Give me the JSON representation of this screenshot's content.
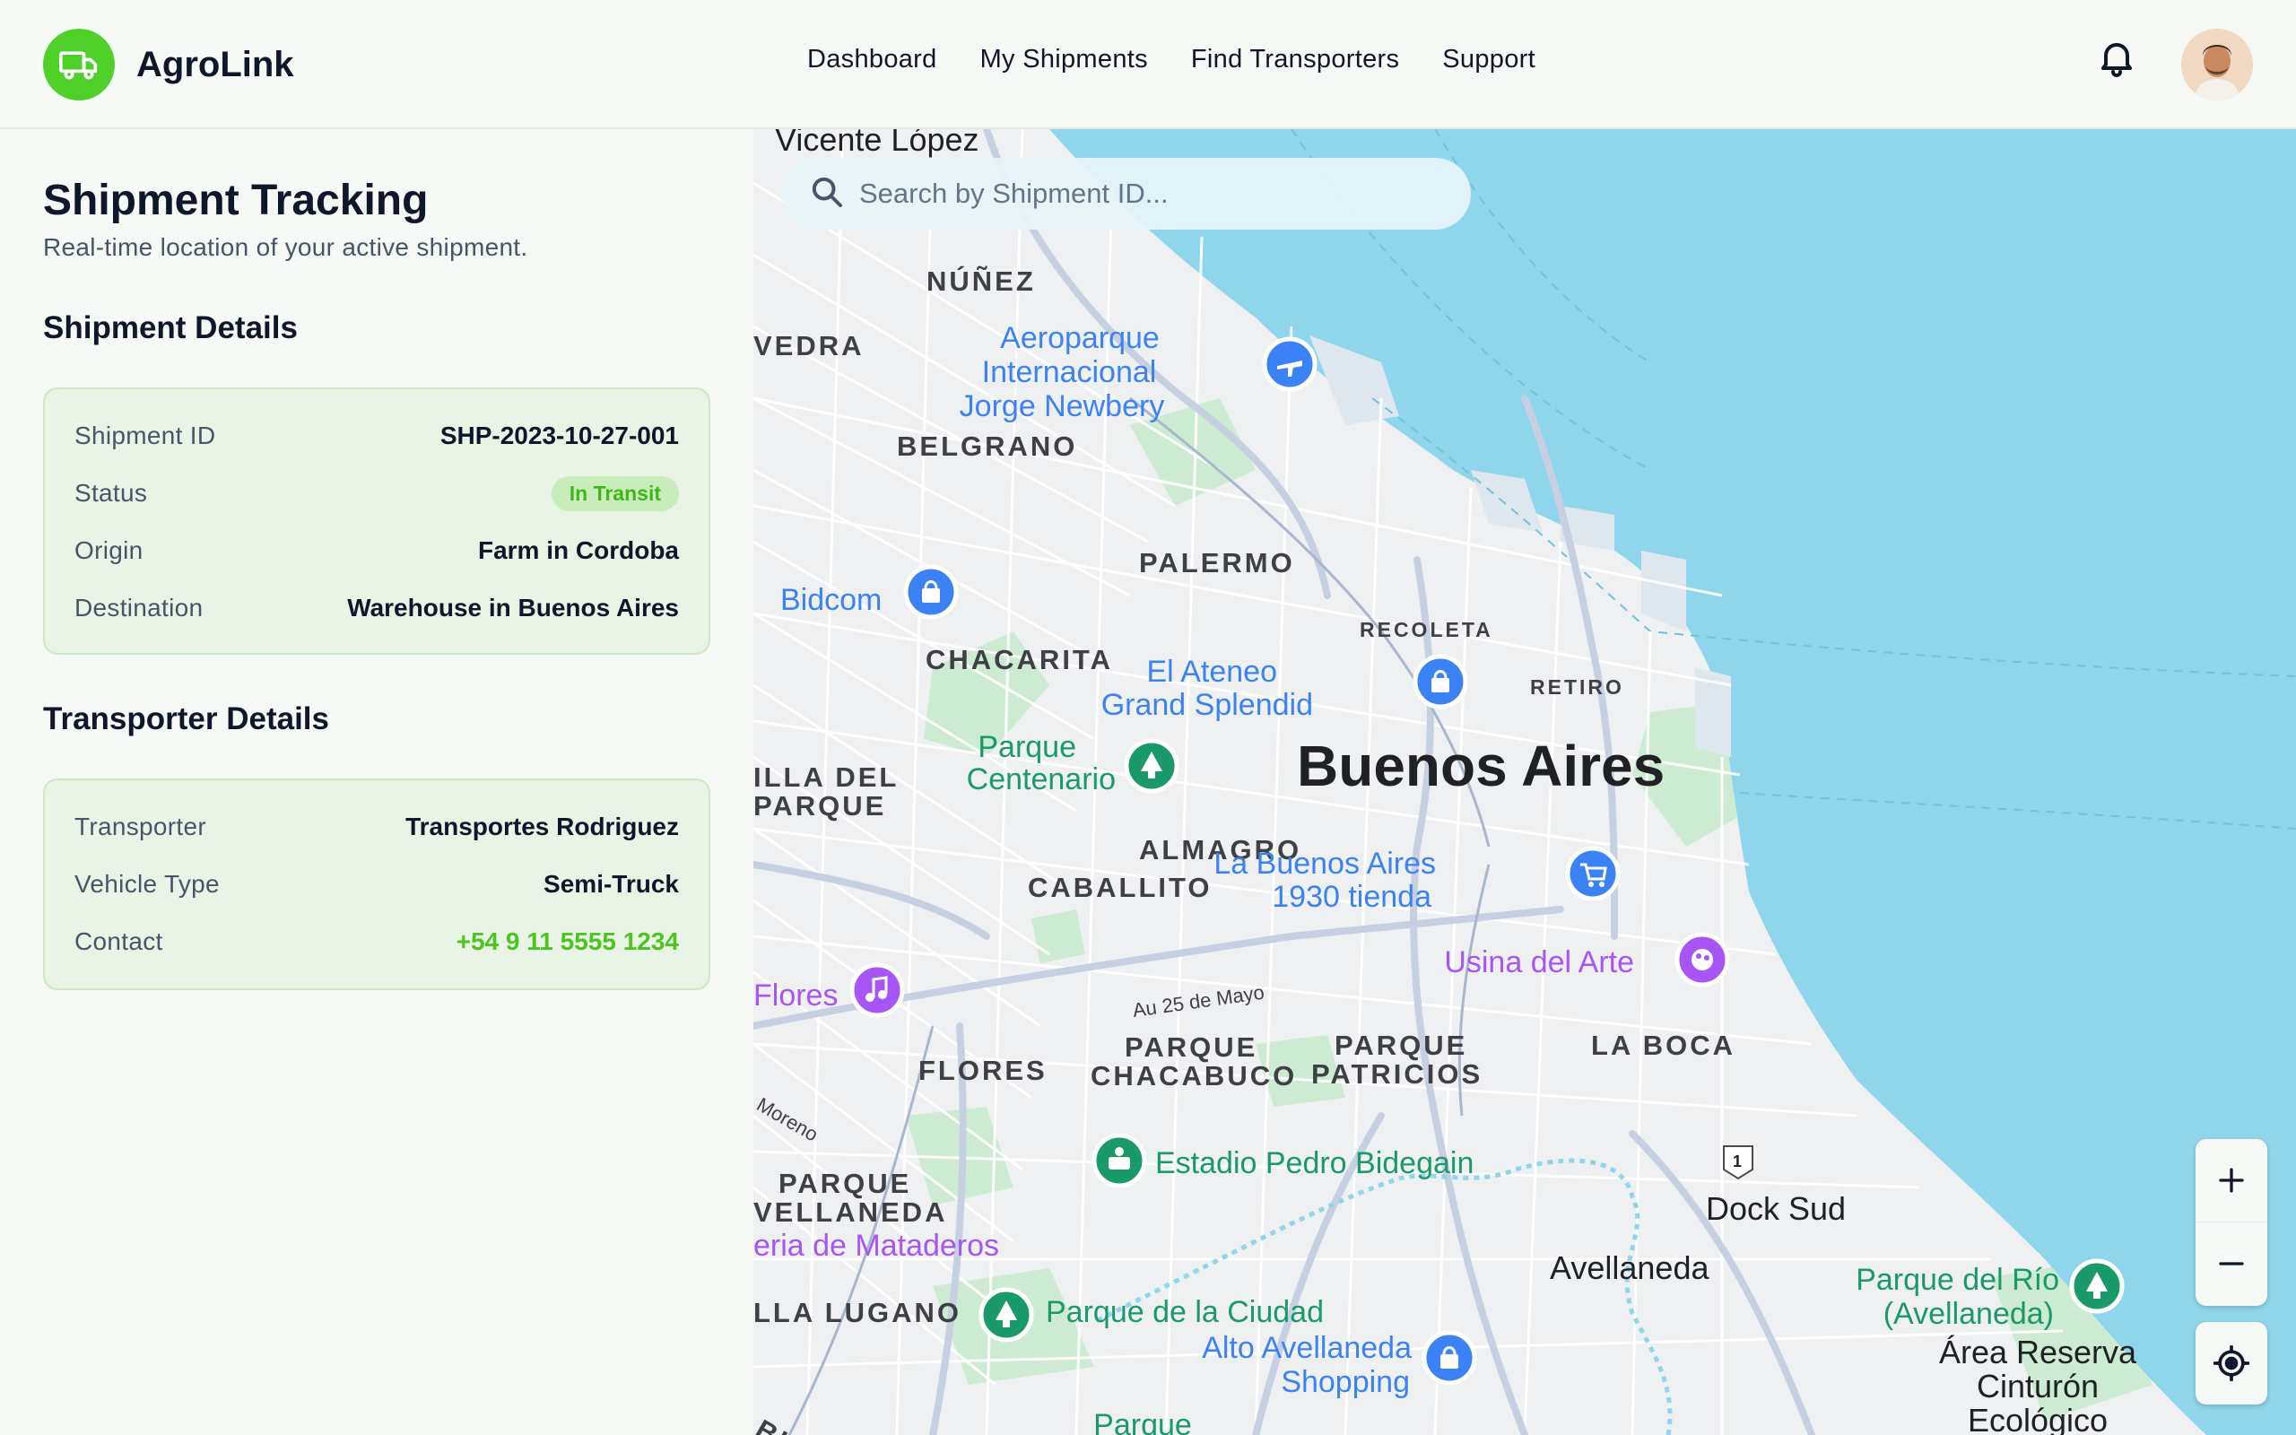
{
  "brand": {
    "name": "AgroLink",
    "logo_icon": "truck-icon",
    "accent": "#4fcf2a"
  },
  "nav": {
    "items": [
      {
        "label": "Dashboard"
      },
      {
        "label": "My Shipments"
      },
      {
        "label": "Find Transporters"
      },
      {
        "label": "Support"
      }
    ]
  },
  "header_icons": {
    "notifications": "bell-icon",
    "profile": "avatar"
  },
  "page": {
    "title": "Shipment Tracking",
    "subtitle": "Real-time location of your active shipment."
  },
  "shipment": {
    "section_title": "Shipment Details",
    "rows": [
      {
        "label": "Shipment ID",
        "value": "SHP-2023-10-27-001"
      },
      {
        "label": "Status",
        "value": "In Transit"
      },
      {
        "label": "Origin",
        "value": "Farm in Cordoba"
      },
      {
        "label": "Destination",
        "value": "Warehouse in Buenos Aires"
      }
    ],
    "status_color": "#3fb61a"
  },
  "transporter": {
    "section_title": "Transporter Details",
    "rows": [
      {
        "label": "Transporter",
        "value": "Transportes Rodriguez"
      },
      {
        "label": "Vehicle Type",
        "value": "Semi-Truck"
      },
      {
        "label": "Contact",
        "value": "+54 9 11 5555 1234"
      }
    ]
  },
  "search": {
    "placeholder": "Search by Shipment ID..."
  },
  "map": {
    "city": "Buenos Aires",
    "labels": {
      "vicente_lopez": "Vicente López",
      "nunez": "NÚÑEZ",
      "vedra": "VEDRA",
      "belgrano": "BELGRANO",
      "palermo": "PALERMO",
      "chacarita": "CHACARITA",
      "recoleta": "RECOLETA",
      "retiro": "RETIRO",
      "villa_del_parque_1": "ILLA DEL",
      "villa_del_parque_2": "PARQUE",
      "almagro": "ALMAGRO",
      "caballito": "CABALLITO",
      "flores_dist": "FLORES",
      "parque_chacabuco_1": "PARQUE",
      "parque_chacabuco_2": "CHACABUCO",
      "parque_patricios_1": "PARQUE",
      "parque_patricios_2": "PATRICIOS",
      "la_boca": "LA BOCA",
      "parque_avellaneda_1": "PARQUE",
      "parque_avellaneda_2": "VELLANEDA",
      "villa_lugano": "LLA LUGANO",
      "dock_sud": "Dock Sud",
      "avellaneda": "Avellaneda",
      "av_25_mayo": "Au 25 de Mayo",
      "moreno": "Moreno",
      "route_1": "1",
      "buf": "BUE",
      "aeroparque_1": "Aeroparque",
      "aeroparque_2": "Internacional",
      "aeroparque_3": "Jorge Newbery",
      "bidcom": "Bidcom",
      "ateneo_1": "El Ateneo",
      "ateneo_2": "Grand Splendid",
      "centenario_1": "Parque",
      "centenario_2": "Centenario",
      "la_bs_as_1": "La Buenos Aires",
      "la_bs_as_2": "1930 tienda",
      "usina": "Usina del Arte",
      "flores_poi": "Flores",
      "estadio": "Estadio Pedro Bidegain",
      "mataderos": "eria de Mataderos",
      "parque_ciudad": "Parque de la Ciudad",
      "alto_av_1": "Alto Avellaneda",
      "alto_av_2": "Shopping",
      "parque_rio_1": "Parque del Río",
      "parque_rio_2": "(Avellaneda)",
      "reserva_1": "Área Reserva",
      "reserva_2": "Cinturón",
      "reserva_3": "Ecológico",
      "parque_bottom": "Parque"
    },
    "controls": [
      "zoom-in-icon",
      "zoom-out-icon",
      "locate-icon"
    ],
    "water_color": "#8fd6ec",
    "land_color": "#eef0f2",
    "park_color": "#cdebd2"
  }
}
